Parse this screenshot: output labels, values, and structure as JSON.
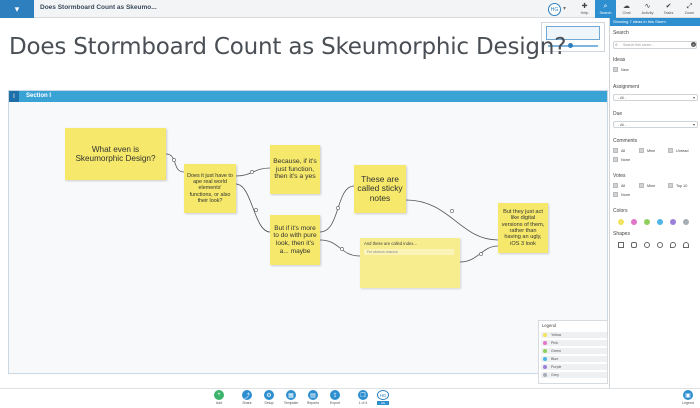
{
  "header": {
    "doc_title": "Does Stormboard Count as Skeumo...",
    "user_initials": "HG",
    "tools": [
      {
        "label": "Help",
        "icon": "plus-help-icon"
      },
      {
        "label": "Search",
        "icon": "search-icon"
      },
      {
        "label": "Chat",
        "icon": "chat-icon"
      },
      {
        "label": "Activity",
        "icon": "activity-icon"
      },
      {
        "label": "Tasks",
        "icon": "check-icon"
      },
      {
        "label": "Zoom",
        "icon": "zoom-icon"
      }
    ]
  },
  "storm": {
    "title": "Does Stormboard Count as Skeumorphic Design?",
    "section_number": "I",
    "section_label": "Section I"
  },
  "notes": {
    "n1": "What even is Skeumorphic Design?",
    "n2": "Does it just have to ape real world elements' functions, or also their look?",
    "n3": "Because, if it's just function, then it's a yes",
    "n4": "But if it's more to do with pure look, then it's a... maybe",
    "n5": "These are called sticky notes",
    "n6_head": "And these are called index...",
    "n6_line": "For obvious reasons",
    "n7": "But they just act like digital versions of them, rather than having an ugly, iOS 3 look"
  },
  "legend": {
    "title": "Legend",
    "items": [
      {
        "label": "Yellow",
        "color": "#f2e35e"
      },
      {
        "label": "Pink",
        "color": "#e277c7"
      },
      {
        "label": "Green",
        "color": "#8fcf5b"
      },
      {
        "label": "Blue",
        "color": "#4fb4e6"
      },
      {
        "label": "Purple",
        "color": "#9b7fd8"
      },
      {
        "label": "Grey",
        "color": "#a7aeb5"
      }
    ]
  },
  "panel": {
    "banner": "Showing 7 ideas in this Storm",
    "search_label": "Search",
    "search_placeholder": "Search this storm...",
    "ideas_label": "Ideas",
    "ideas_new": "New",
    "assignment_label": "Assignment",
    "assignment_value": "- All -",
    "due_label": "Due",
    "due_value": "- All -",
    "comments_label": "Comments",
    "comments_all": "All",
    "comments_mine": "Mine",
    "comments_unread": "Unread",
    "comments_none": "None",
    "votes_label": "Votes",
    "votes_all": "All",
    "votes_mine": "Mine",
    "votes_top": "Top 10",
    "votes_none": "None",
    "colors_label": "Colors",
    "colors": [
      "#f2e35e",
      "#e277c7",
      "#8fcf5b",
      "#4fb4e6",
      "#9b7fd8",
      "#a7aeb5"
    ],
    "shapes_label": "Shapes"
  },
  "bottombar": {
    "items": [
      "Add",
      "Share",
      "Setup",
      "Template",
      "Reports",
      "Export",
      "1 of 4"
    ],
    "user_initials": "HG",
    "user_tag": "HG",
    "legend": "Legend"
  }
}
